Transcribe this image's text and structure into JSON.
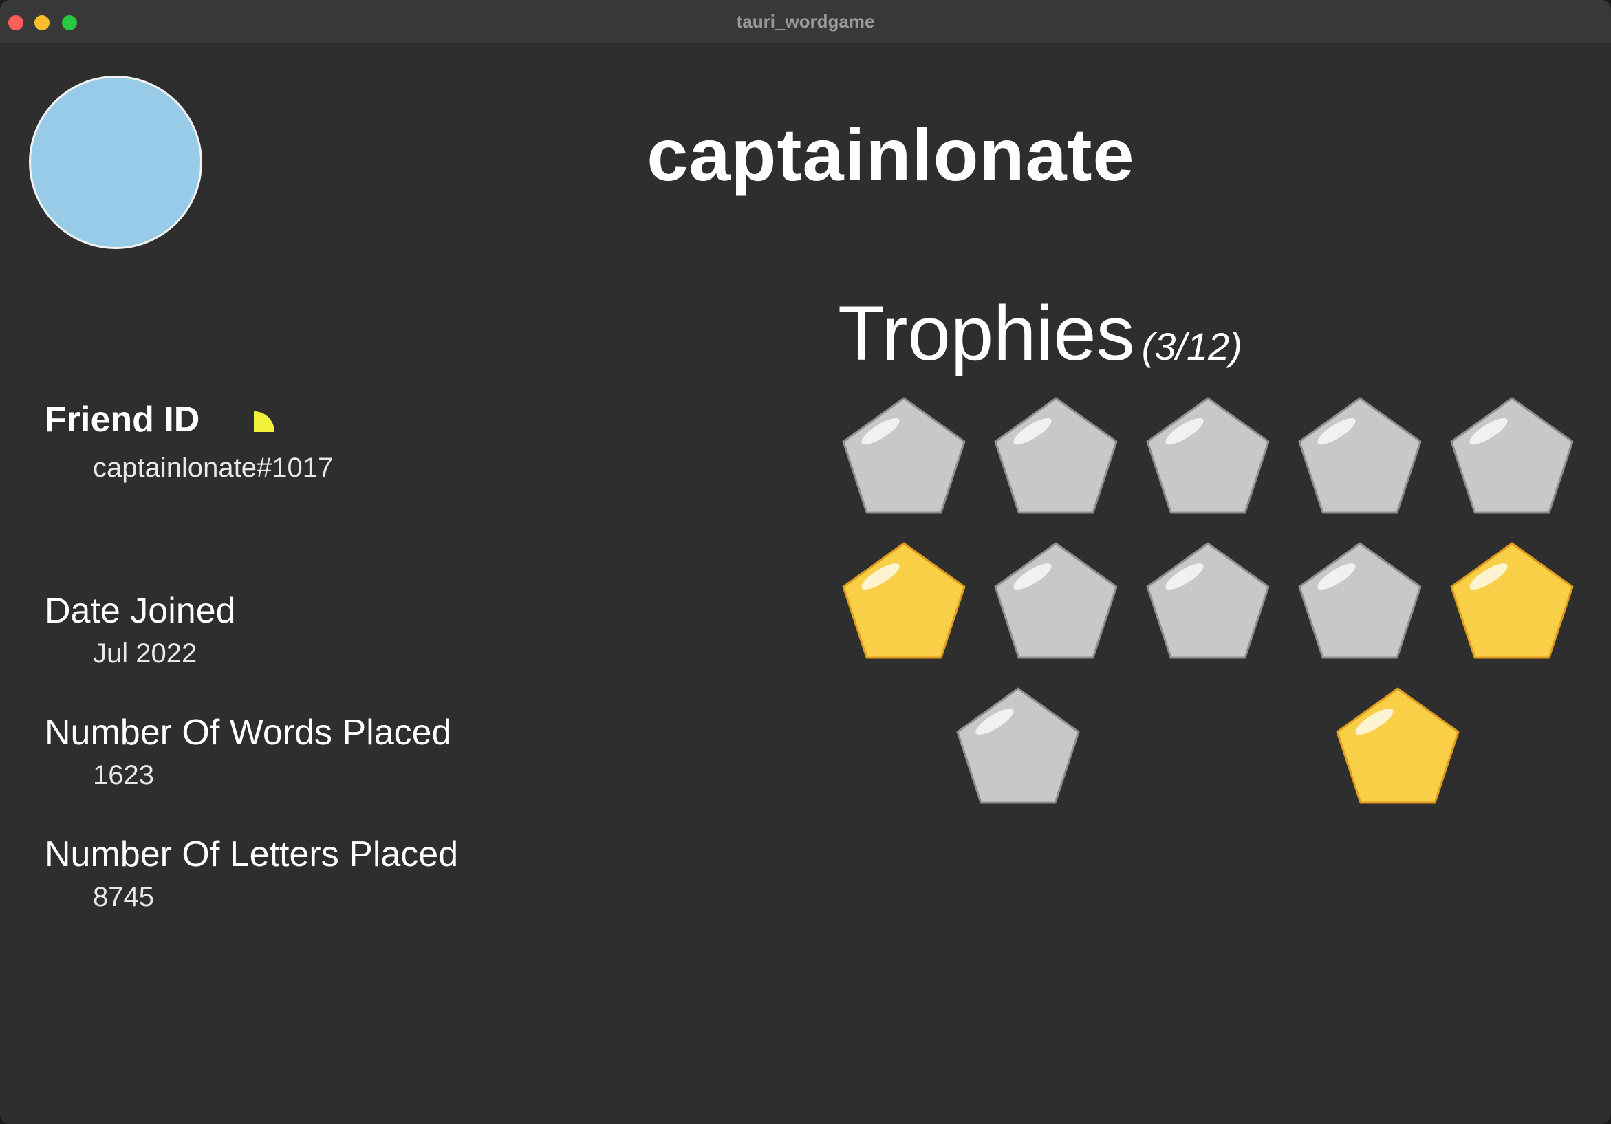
{
  "window": {
    "title": "tauri_wordgame"
  },
  "profile": {
    "username": "captainlonate",
    "avatar_color": "#98cbe8"
  },
  "stats": {
    "friend_id_label": "Friend ID",
    "friend_id_value": "captainlonate#1017",
    "date_joined_label": "Date Joined",
    "date_joined_value": "Jul 2022",
    "words_label": "Number Of Words Placed",
    "words_value": "1623",
    "letters_label": "Number Of Letters Placed",
    "letters_value": "8745"
  },
  "trophies": {
    "heading": "Trophies",
    "count": "(3/12)",
    "earned_color": "#f8cf46",
    "unearned_color": "#c8c8c8",
    "items": [
      {
        "earned": false
      },
      {
        "earned": false
      },
      {
        "earned": false
      },
      {
        "earned": false
      },
      {
        "earned": false
      },
      {
        "earned": true
      },
      {
        "earned": false
      },
      {
        "earned": false
      },
      {
        "earned": false
      },
      {
        "earned": true
      },
      {
        "earned": false
      },
      {
        "earned": true
      }
    ]
  }
}
